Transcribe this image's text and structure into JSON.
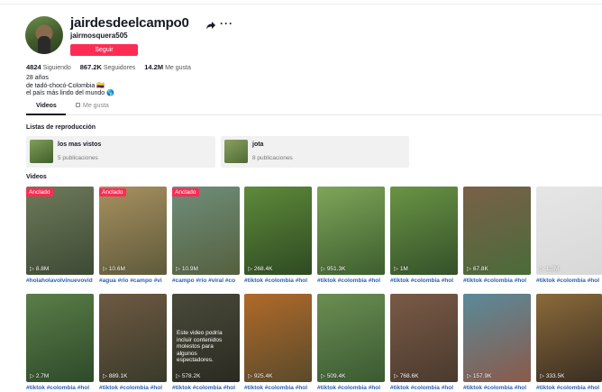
{
  "profile": {
    "username": "jairdesdeelcampo0",
    "handle": "jairmosquera505",
    "follow_label": "Seguir",
    "more_label": "···",
    "stats": {
      "following": "4824",
      "following_label": "Siguiendo",
      "followers": "867.2K",
      "followers_label": "Seguidores",
      "likes": "14.2M",
      "likes_label": "Me gusta"
    },
    "bio": [
      "28 años",
      "de tadó-chocó-Colombia 🇨🇴",
      "el país más lindo del mundo 🌎"
    ]
  },
  "tabs": [
    {
      "label": "Videos",
      "active": true
    },
    {
      "label": "Me gusta",
      "active": false
    }
  ],
  "playlists_title": "Listas de reproducción",
  "playlists": [
    {
      "name": "los mas vistos",
      "count": "5 publicaciones"
    },
    {
      "name": "jota",
      "count": "8 publicaciones"
    }
  ],
  "videos_title": "Videos",
  "videos": [
    {
      "views": "8.8M",
      "pinned": "Anclado",
      "caption": "#holaholavolvinuevovid",
      "c1": "#6f7a5a",
      "c2": "#3d4a34"
    },
    {
      "views": "10.6M",
      "pinned": "Anclado",
      "caption": "#agua #rio #campo #vi",
      "c1": "#a89060",
      "c2": "#5e5a3a"
    },
    {
      "views": "10.9M",
      "pinned": "Anclado",
      "caption": "#campo #rio #viral #co",
      "c1": "#6f8e7a",
      "c2": "#55603f"
    },
    {
      "views": "268.4K",
      "pinned": "",
      "caption": "#tiktok #colombia #hol",
      "c1": "#5f8a3a",
      "c2": "#2e4a22"
    },
    {
      "views": "951.3K",
      "pinned": "",
      "caption": "#tiktok #colombia #hol",
      "c1": "#7ea55a",
      "c2": "#3d5e2e"
    },
    {
      "views": "1M",
      "pinned": "",
      "caption": "#tiktok #colombia #hol",
      "c1": "#6a9444",
      "c2": "#34512a"
    },
    {
      "views": "67.8K",
      "pinned": "",
      "caption": "#tiktok #colombia #hol",
      "c1": "#7a6048",
      "c2": "#4a6b3a"
    },
    {
      "views": "1.3M",
      "pinned": "",
      "caption": "#tiktok #colombia #hol",
      "c1": "#e6e6e6",
      "c2": "#d8d8d8"
    },
    {
      "views": "2.7M",
      "pinned": "",
      "caption": "#tiktok #colombia #hol",
      "c1": "#5a7e48",
      "c2": "#2e4a2a"
    },
    {
      "views": "889.1K",
      "pinned": "",
      "caption": "#tiktok #colombia #hol",
      "c1": "#6e5a42",
      "c2": "#3a3a2a"
    },
    {
      "views": "578.2K",
      "pinned": "",
      "warning": "Este video podría incluir contenidos molestos para algunos espectadores.",
      "caption": "#tiktok #colombia #hol",
      "c1": "#4a4a3a",
      "c2": "#2a2a22"
    },
    {
      "views": "925.4K",
      "pinned": "",
      "caption": "#tiktok #colombia #hol",
      "c1": "#b06a2a",
      "c2": "#5a4a2a"
    },
    {
      "views": "509.4K",
      "pinned": "",
      "caption": "#tiktok #colombia #hol",
      "c1": "#6b8e52",
      "c2": "#3a5a32"
    },
    {
      "views": "768.6K",
      "pinned": "",
      "caption": "#tiktok #colombia #hol",
      "c1": "#7a5a46",
      "c2": "#4a3a2e"
    },
    {
      "views": "157.9K",
      "pinned": "",
      "caption": "#tiktok #colombia #hol",
      "c1": "#5a8a9a",
      "c2": "#8a5a4a"
    },
    {
      "views": "333.5K",
      "pinned": "",
      "caption": "#tiktok #colombia #hol",
      "c1": "#8a6a3a",
      "c2": "#3a2e22"
    }
  ],
  "colors": {
    "accent": "#fe2c55",
    "caption": "#2b5fb3"
  }
}
